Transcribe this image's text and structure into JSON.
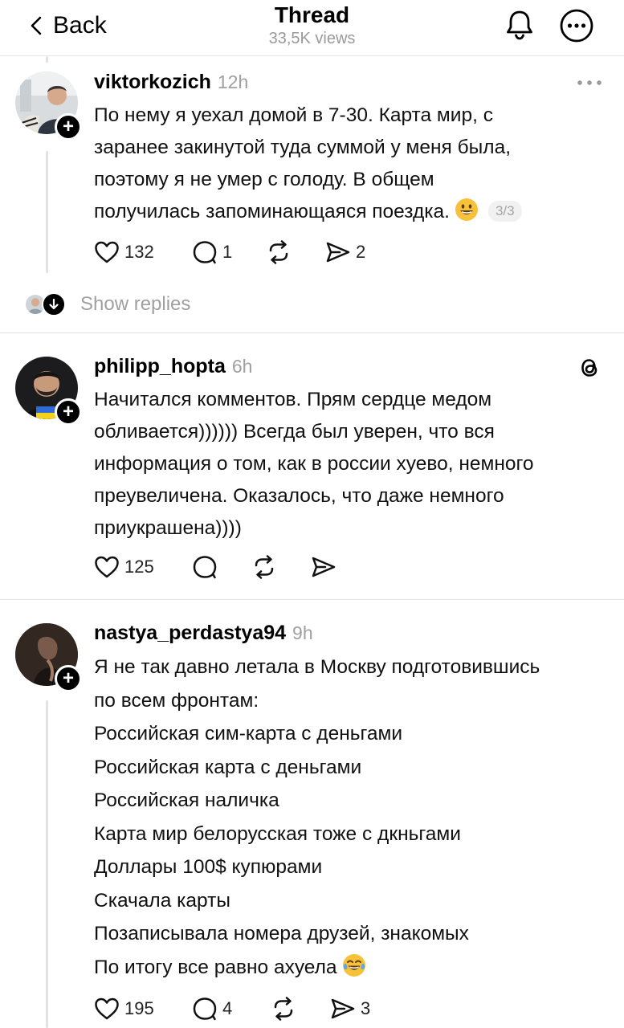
{
  "header": {
    "back_label": "Back",
    "title": "Thread",
    "views": "33,5K views"
  },
  "posts": [
    {
      "username": "viktorkozich",
      "time": "12h",
      "lines": [
        "По нему я уехал домой в 7-30. Карта мир, с",
        "заранее закинутой туда суммой у меня была,",
        "поэтому я не умер с голоду. В общем",
        "получилась запоминающаяся поездка."
      ],
      "page_badge": "3/3",
      "likes": "132",
      "replies": "1",
      "reposts": "",
      "shares": "2"
    },
    {
      "username": "philipp_hopta",
      "time": "6h",
      "lines": [
        "Начитался комментов. Прям сердце медом",
        "обливается)))))) Всегда был уверен, что вся",
        "информация о том, как в россии хуево, немного",
        "преувеличена. Оказалось, что даже немного",
        "приукрашена))))"
      ],
      "likes": "125",
      "replies": "",
      "reposts": "",
      "shares": ""
    },
    {
      "username": "nastya_perdastya94",
      "time": "9h",
      "lines": [
        "Я не так давно летала в Москву подготовившись",
        "по всем фронтам:",
        "Российская сим-карта с деньгами",
        "Российская карта с деньгами",
        "Российская наличка",
        "Карта мир белорусская тоже с дкньгами",
        "Доллары 100$ купюрами",
        "Скачала карты",
        "Позаписывала номера друзей, знакомых",
        "По итогу все равно ахуела"
      ],
      "likes": "195",
      "replies": "4",
      "reposts": "",
      "shares": "3"
    }
  ],
  "show_replies_label": "Show replies",
  "colors": {
    "muted": "#a0a0a0",
    "divider": "#e3e3e3",
    "emoji_yellow": "#f7c23a"
  }
}
